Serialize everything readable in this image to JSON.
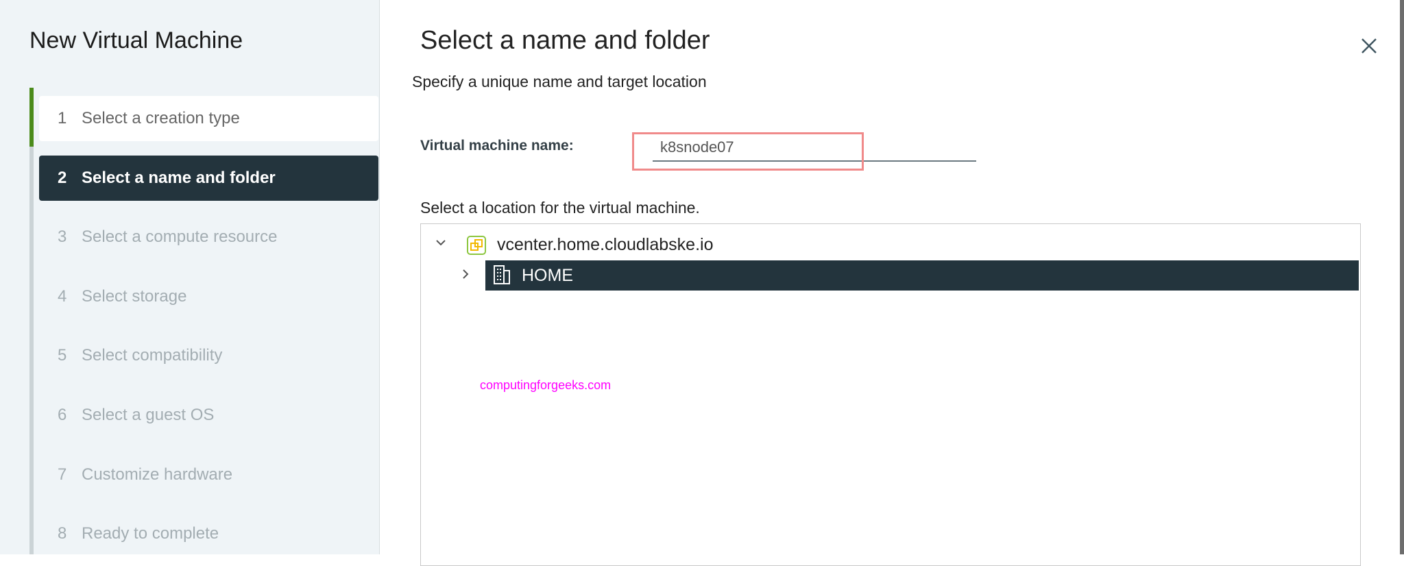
{
  "wizard": {
    "title": "New Virtual Machine",
    "steps": [
      {
        "num": "1",
        "label": "Select a creation type",
        "state": "done"
      },
      {
        "num": "2",
        "label": "Select a name and folder",
        "state": "current"
      },
      {
        "num": "3",
        "label": "Select a compute resource",
        "state": "pending"
      },
      {
        "num": "4",
        "label": "Select storage",
        "state": "pending"
      },
      {
        "num": "5",
        "label": "Select compatibility",
        "state": "pending"
      },
      {
        "num": "6",
        "label": "Select a guest OS",
        "state": "pending"
      },
      {
        "num": "7",
        "label": "Customize hardware",
        "state": "pending"
      },
      {
        "num": "8",
        "label": "Ready to complete",
        "state": "pending"
      }
    ]
  },
  "main": {
    "title": "Select a name and folder",
    "subtitle": "Specify a unique name and target location",
    "vm_name_label": "Virtual machine name:",
    "vm_name_value": "k8snode07",
    "location_label": "Select a location for the virtual machine.",
    "tree": {
      "root": "vcenter.home.cloudlabske.io",
      "child": "HOME"
    }
  },
  "watermark": "computingforgeeks.com",
  "colors": {
    "accent_dark": "#23343d",
    "done_green": "#4b8b1b",
    "highlight_red": "#f08a8a"
  }
}
